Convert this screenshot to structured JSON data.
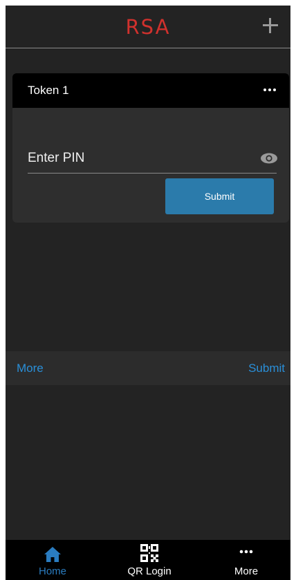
{
  "header": {
    "logo_text": "RSA",
    "add_icon": "plus-icon"
  },
  "token": {
    "name": "Token 1",
    "menu_icon": "more-horizontal-icon",
    "pin_placeholder": "Enter PIN",
    "pin_value": "",
    "visibility_icon": "eye-icon",
    "submit_label": "Submit"
  },
  "accessory_bar": {
    "left_label": "More",
    "right_label": "Submit"
  },
  "tab_bar": {
    "items": [
      {
        "label": "Home",
        "icon": "home-icon",
        "active": true
      },
      {
        "label": "QR Login",
        "icon": "qr-code-icon",
        "active": false
      },
      {
        "label": "More",
        "icon": "more-horizontal-icon",
        "active": false
      }
    ]
  },
  "colors": {
    "brand_red": "#d0312d",
    "accent_blue": "#2a8fd8",
    "button_blue": "#2b7bab",
    "background": "#232323",
    "card": "#2e2e2e"
  }
}
